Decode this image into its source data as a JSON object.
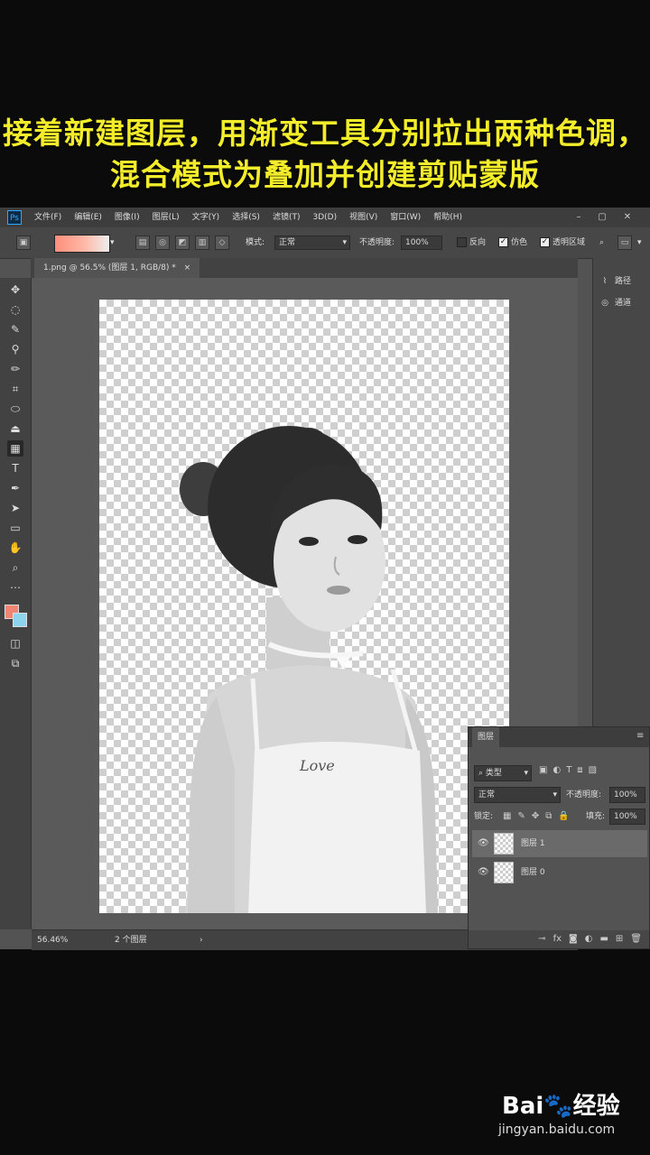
{
  "caption": {
    "line1": "接着新建图层，用渐变工具分别拉出两种色调，",
    "line2": "混合模式为叠加并创建剪贴蒙版"
  },
  "menu": {
    "logo": "Ps",
    "items": [
      "文件(F)",
      "编辑(E)",
      "图像(I)",
      "图层(L)",
      "文字(Y)",
      "选择(S)",
      "滤镜(T)",
      "3D(D)",
      "视图(V)",
      "窗口(W)",
      "帮助(H)"
    ],
    "minimize": "–",
    "restore": "▢",
    "close": "✕"
  },
  "options": {
    "mode_label": "模式:",
    "mode_value": "正常",
    "opacity_label": "不透明度:",
    "opacity_value": "100%",
    "reverse_label": "反向",
    "dither_label": "仿色",
    "transparency_label": "透明区域",
    "reverse_checked": false,
    "dither_checked": true,
    "transparency_checked": true,
    "fg_color": "#f08672",
    "bg_color": "#8dd4ef"
  },
  "document": {
    "tab_title": "1.png @ 56.5% (图层 1, RGB/8) *",
    "tab_close": "×",
    "zoom": "56.46%",
    "layer_count": "2 个图层"
  },
  "dock": {
    "item1": "路径",
    "item2": "通道"
  },
  "layers_panel": {
    "tab": "图层",
    "filter_value": "类型",
    "blend_mode": "正常",
    "opacity_label": "不透明度:",
    "opacity_value": "100%",
    "lock_label": "锁定:",
    "fill_label": "填充:",
    "fill_value": "100%",
    "layers": [
      {
        "name": "图层 1",
        "selected": true
      },
      {
        "name": "图层 0",
        "selected": false
      }
    ]
  },
  "watermark": {
    "logo": "Bai🐾经验",
    "url": "jingyan.baidu.com"
  }
}
